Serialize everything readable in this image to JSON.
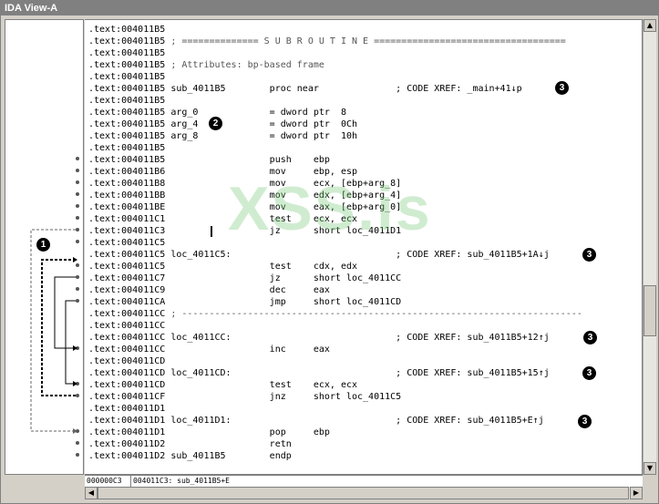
{
  "window": {
    "title": "IDA View-A"
  },
  "listing": [
    {
      "addr": ".text:004011B5",
      "text": ""
    },
    {
      "addr": ".text:004011B5",
      "text": " ; ============== S U B R O U T I N E ===================================",
      "comment": true
    },
    {
      "addr": ".text:004011B5",
      "text": ""
    },
    {
      "addr": ".text:004011B5",
      "text": " ; Attributes: bp-based frame",
      "comment": true
    },
    {
      "addr": ".text:004011B5",
      "text": ""
    },
    {
      "addr": ".text:004011B5",
      "text": " sub_4011B5        proc near              ; CODE XREF: _main+41↓p"
    },
    {
      "addr": ".text:004011B5",
      "text": ""
    },
    {
      "addr": ".text:004011B5",
      "text": " arg_0             = dword ptr  8"
    },
    {
      "addr": ".text:004011B5",
      "text": " arg_4             = dword ptr  0Ch"
    },
    {
      "addr": ".text:004011B5",
      "text": " arg_8             = dword ptr  10h"
    },
    {
      "addr": ".text:004011B5",
      "text": ""
    },
    {
      "addr": ".text:004011B5",
      "text": "                   push    ebp"
    },
    {
      "addr": ".text:004011B6",
      "text": "                   mov     ebp, esp"
    },
    {
      "addr": ".text:004011B8",
      "text": "                   mov     ecx, [ebp+arg_8]"
    },
    {
      "addr": ".text:004011BB",
      "text": "                   mov     edx, [ebp+arg_4]"
    },
    {
      "addr": ".text:004011BE",
      "text": "                   mov     eax, [ebp+arg_0]"
    },
    {
      "addr": ".text:004011C1",
      "text": "                   test    ecx, ecx"
    },
    {
      "addr": ".text:004011C3",
      "text": "                   jz      short loc_4011D1"
    },
    {
      "addr": ".text:004011C5",
      "text": ""
    },
    {
      "addr": ".text:004011C5",
      "text": " loc_4011C5:                              ; CODE XREF: sub_4011B5+1A↓j"
    },
    {
      "addr": ".text:004011C5",
      "text": "                   test    cdx, edx"
    },
    {
      "addr": ".text:004011C7",
      "text": "                   jz      short loc_4011CC"
    },
    {
      "addr": ".text:004011C9",
      "text": "                   dec     eax"
    },
    {
      "addr": ".text:004011CA",
      "text": "                   jmp     short loc_4011CD"
    },
    {
      "addr": ".text:004011CC",
      "text": " ; -------------------------------------------------------------------------",
      "comment": true
    },
    {
      "addr": ".text:004011CC",
      "text": ""
    },
    {
      "addr": ".text:004011CC",
      "text": " loc_4011CC:                              ; CODE XREF: sub_4011B5+12↑j"
    },
    {
      "addr": ".text:004011CC",
      "text": "                   inc     eax"
    },
    {
      "addr": ".text:004011CD",
      "text": ""
    },
    {
      "addr": ".text:004011CD",
      "text": " loc_4011CD:                              ; CODE XREF: sub_4011B5+15↑j"
    },
    {
      "addr": ".text:004011CD",
      "text": "                   test    ecx, ecx"
    },
    {
      "addr": ".text:004011CF",
      "text": "                   jnz     short loc_4011C5"
    },
    {
      "addr": ".text:004011D1",
      "text": ""
    },
    {
      "addr": ".text:004011D1",
      "text": " loc_4011D1:                              ; CODE XREF: sub_4011B5+E↑j"
    },
    {
      "addr": ".text:004011D1",
      "text": "                   pop     ebp"
    },
    {
      "addr": ".text:004011D2",
      "text": "                   retn"
    },
    {
      "addr": ".text:004011D2",
      "text": " sub_4011B5        endp"
    }
  ],
  "callouts": [
    "1",
    "2",
    "3",
    "3",
    "3",
    "3",
    "3"
  ],
  "watermark": "XSS.is",
  "statusbar": {
    "offset": "000000C3",
    "location": "004011C3: sub_4011B5+E"
  },
  "scroll": {
    "up": "▲",
    "down": "▼",
    "left": "◀",
    "right": "▶"
  },
  "colors": {
    "title_bg": "#808080",
    "frame": "#d4d0c8",
    "watermark": "#78c878"
  }
}
